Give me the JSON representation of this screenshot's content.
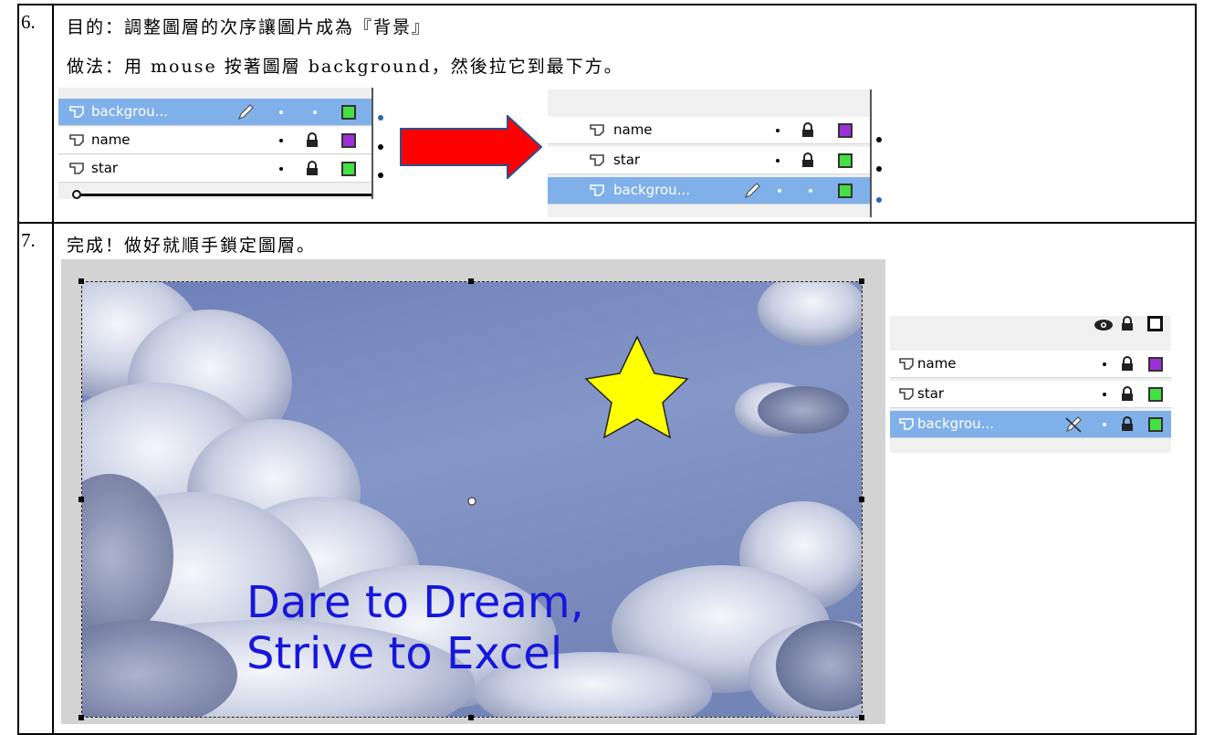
{
  "steps": [
    {
      "number": "6.",
      "goal": "目的：調整圖層的次序讓圖片成為『背景』",
      "method": "做法：用 mouse 按著圖層 background，然後拉它到最下方。"
    },
    {
      "number": "7.",
      "text": "完成！做好就順手鎖定圖層。"
    }
  ],
  "panel_before": {
    "layers": [
      {
        "name": "backgrou...",
        "selected": true,
        "swatch": "#44e044"
      },
      {
        "name": "name",
        "selected": false,
        "swatch": "#9b30d9"
      },
      {
        "name": "star",
        "selected": false,
        "swatch": "#44e044"
      }
    ]
  },
  "panel_after": {
    "layers": [
      {
        "name": "name",
        "selected": false,
        "swatch": "#9b30d9"
      },
      {
        "name": "star",
        "selected": false,
        "swatch": "#44e044"
      },
      {
        "name": "backgrou...",
        "selected": true,
        "swatch": "#44e044"
      }
    ]
  },
  "panel_locked": {
    "layers": [
      {
        "name": "name",
        "selected": false,
        "swatch": "#9b30d9"
      },
      {
        "name": "star",
        "selected": false,
        "swatch": "#44e044"
      },
      {
        "name": "backgrou...",
        "selected": true,
        "swatch": "#44e044"
      }
    ]
  },
  "stage": {
    "line1": "Dare to Dream,",
    "line2": "Strive to Excel"
  },
  "colors": {
    "arrow": "#ff0000",
    "selected_row": "#7fb0ea",
    "star_fill": "#ffff00",
    "stage_text": "#1616dc"
  },
  "icons": [
    "layer-icon",
    "pencil-icon",
    "lock-icon",
    "eye-icon",
    "outline-square-icon",
    "crossed-pencil-icon",
    "arrow-right-icon",
    "star-shape"
  ]
}
